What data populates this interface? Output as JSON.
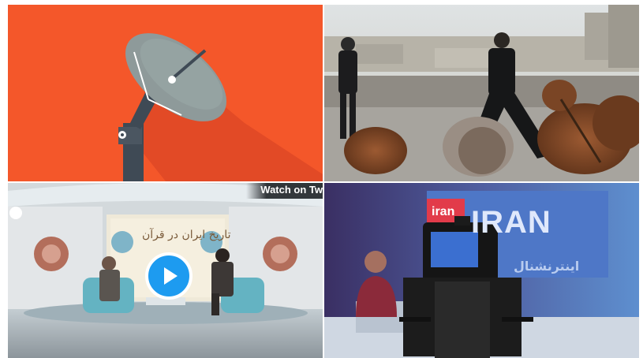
{
  "tiles": [
    {
      "id": "satellite-illustration",
      "icon": "satellite-dish-illustration"
    },
    {
      "id": "rooftop-photo",
      "icon": "rooftop-dishes-photo"
    },
    {
      "id": "studio-video",
      "icon": "tv-studio-photo",
      "overlay": {
        "watch_label": "Watch on Tw",
        "play_icon": "play-icon"
      },
      "sign_text": "تاریخ ایران در قرآن"
    },
    {
      "id": "news-camera-photo",
      "icon": "news-camera-photo",
      "sign": {
        "prefix": "iran",
        "main": "IRAN",
        "secondary": "اینترنشنال"
      }
    }
  ],
  "colors": {
    "illustration_bg": "#f4572a",
    "play_button": "#1d9bf0"
  }
}
